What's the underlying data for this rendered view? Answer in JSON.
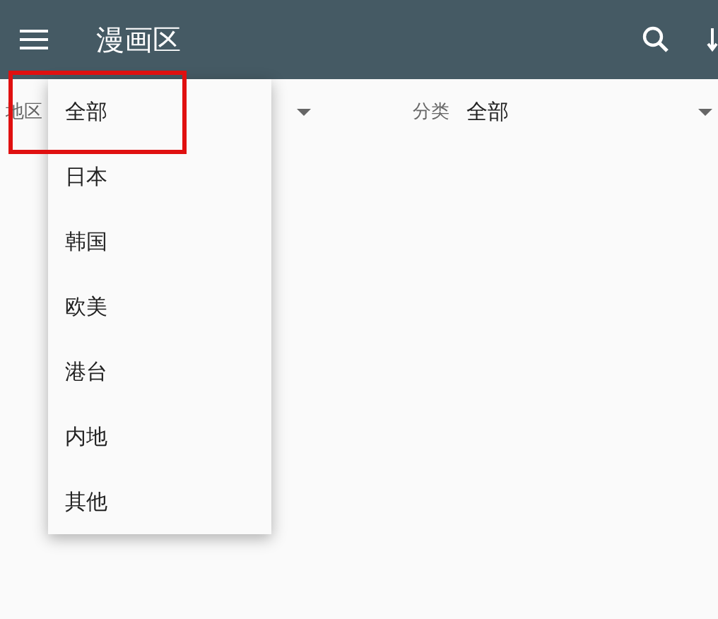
{
  "app_bar": {
    "title": "漫画区"
  },
  "filters": [
    {
      "label": "地区"
    },
    {
      "label": "分类",
      "value": "全部"
    }
  ],
  "menu": {
    "items": [
      "全部",
      "日本",
      "韩国",
      "欧美",
      "港台",
      "内地",
      "其他"
    ]
  }
}
